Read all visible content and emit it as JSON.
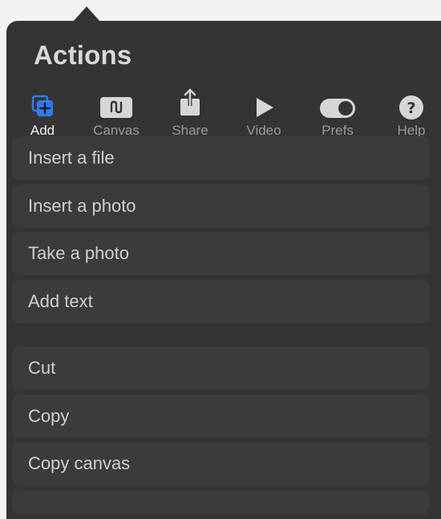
{
  "panel": {
    "title": "Actions"
  },
  "tabs": [
    {
      "label": "Add",
      "icon": "add-layer-icon",
      "active": true
    },
    {
      "label": "Canvas",
      "icon": "canvas-icon",
      "active": false
    },
    {
      "label": "Share",
      "icon": "share-icon",
      "active": false
    },
    {
      "label": "Video",
      "icon": "play-icon",
      "active": false
    },
    {
      "label": "Prefs",
      "icon": "toggle-icon",
      "active": false
    },
    {
      "label": "Help",
      "icon": "help-icon",
      "active": false
    }
  ],
  "menu": {
    "group1": [
      {
        "label": "Insert a file"
      },
      {
        "label": "Insert a photo"
      },
      {
        "label": "Take a photo"
      },
      {
        "label": "Add text"
      }
    ],
    "group2": [
      {
        "label": "Cut"
      },
      {
        "label": "Copy"
      },
      {
        "label": "Copy canvas"
      }
    ]
  },
  "colors": {
    "accent": "#2f7bf6",
    "panel": "#343434",
    "row": "#3b3b3b",
    "text": "#cfcfcf",
    "muted": "#9a9a9a",
    "icon": "#d6d6d6"
  }
}
